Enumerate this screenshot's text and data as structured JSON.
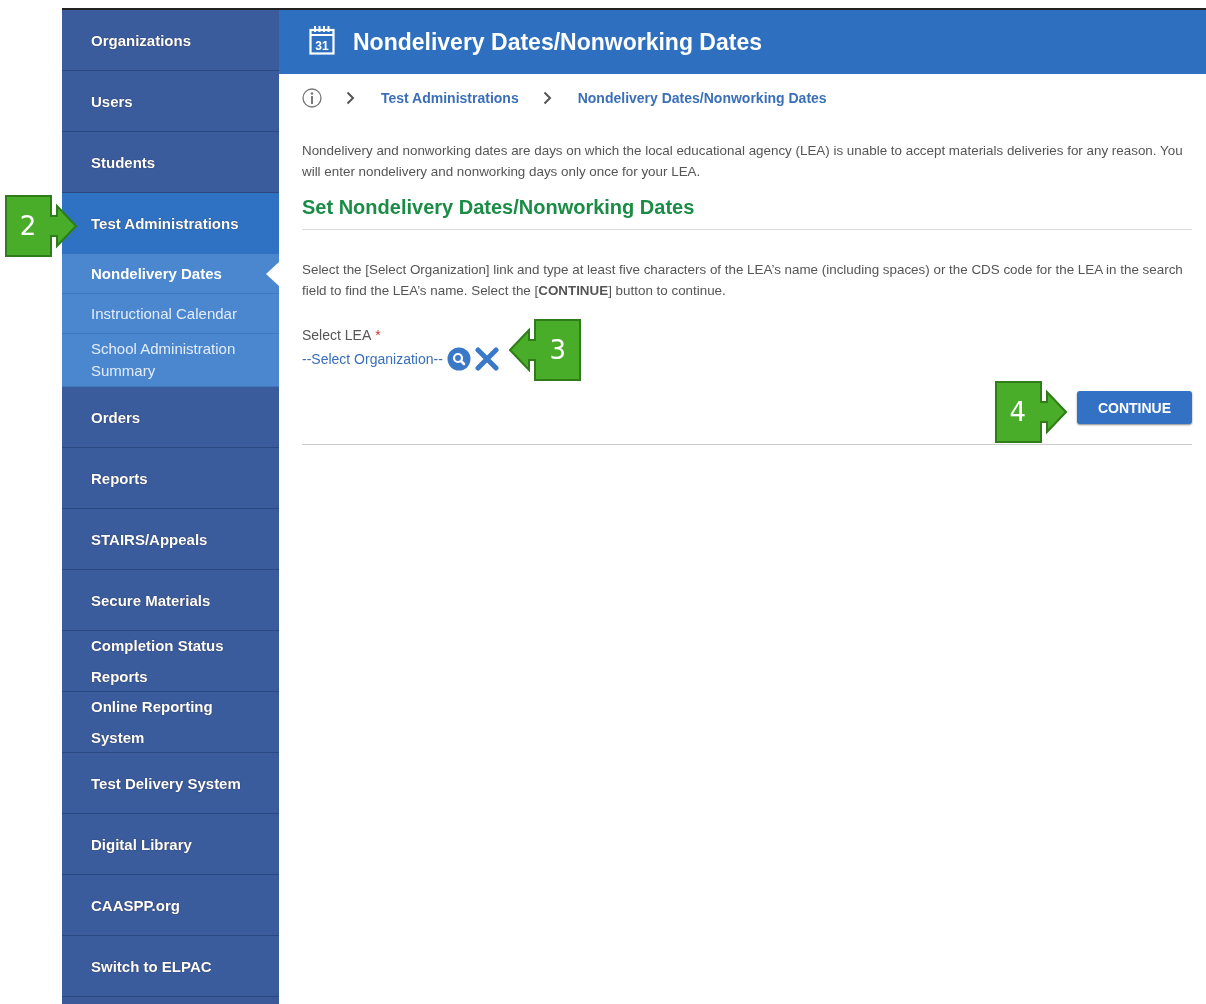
{
  "sidebar": {
    "items": [
      {
        "label": "Organizations",
        "kind": "main",
        "selected": false
      },
      {
        "label": "Users",
        "kind": "main",
        "selected": false
      },
      {
        "label": "Students",
        "kind": "main",
        "selected": false
      },
      {
        "label": "Test Administrations",
        "kind": "main",
        "selected": true,
        "callout": {
          "number": "2",
          "kind": "right"
        }
      },
      {
        "label": "Nondelivery Dates",
        "kind": "sub",
        "selected": true
      },
      {
        "label": "Instructional Calendar",
        "kind": "sub",
        "selected": false
      },
      {
        "label": "School Administration Summary",
        "kind": "sub",
        "selected": false
      },
      {
        "label": "Orders",
        "kind": "main",
        "selected": false
      },
      {
        "label": "Reports",
        "kind": "main",
        "selected": false
      },
      {
        "label": "STAIRS/Appeals",
        "kind": "main",
        "selected": false
      },
      {
        "label": "Secure Materials",
        "kind": "main",
        "selected": false
      },
      {
        "label": "Completion Status Reports",
        "kind": "main",
        "selected": false
      },
      {
        "label": "Online Reporting System",
        "kind": "main",
        "selected": false
      },
      {
        "label": "Test Delivery System",
        "kind": "main",
        "selected": false
      },
      {
        "label": "Digital Library",
        "kind": "main",
        "selected": false
      },
      {
        "label": "CAASPP.org",
        "kind": "main",
        "selected": false
      },
      {
        "label": "Switch to ELPAC",
        "kind": "main",
        "selected": false
      }
    ]
  },
  "header": {
    "title": "Nondelivery Dates/Nonworking Dates",
    "icon_day": "31"
  },
  "breadcrumb": [
    "Test Administrations",
    "Nondelivery Dates/Nonworking Dates"
  ],
  "intro": "Nondelivery and nonworking dates are days on which the local educational agency (LEA) is unable to accept materials deliveries for any reason. You will enter nondelivery and nonworking days only once for your LEA.",
  "section_title": "Set Nondelivery Dates/Nonworking Dates",
  "instructions": "Select the [Select Organization] link and type at least five characters of the LEA’s name (including spaces) or the CDS code for the LEA in the search field to find the LEA’s name. Select the [**CONTINUE**] button to continue.",
  "lea_field": {
    "label": "Select LEA",
    "required": true,
    "required_mark": "*",
    "link": "--Select Organization--",
    "callout": {
      "number": "3",
      "kind": "left"
    }
  },
  "continue_button": {
    "label": "CONTINUE",
    "callout": {
      "number": "4",
      "kind": "right"
    }
  }
}
